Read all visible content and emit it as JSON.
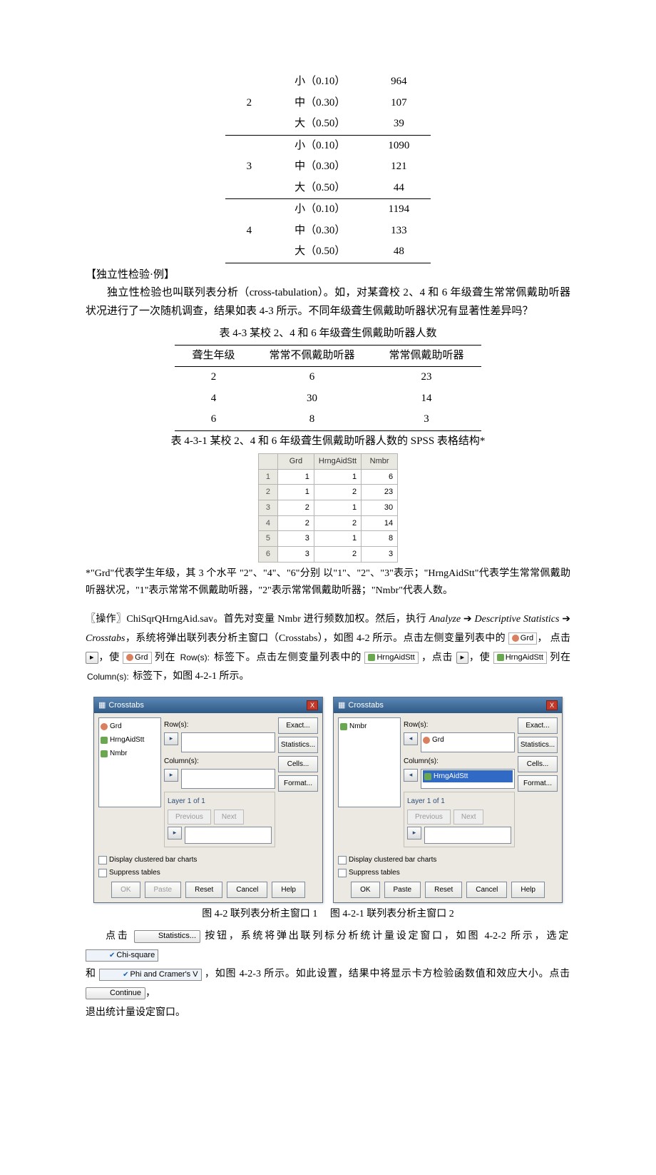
{
  "top_table": {
    "groups": [
      {
        "label": "2",
        "rows": [
          {
            "size": "小（0.10）",
            "n": "964"
          },
          {
            "size": "中（0.30）",
            "n": "107"
          },
          {
            "size": "大（0.50）",
            "n": "39"
          }
        ]
      },
      {
        "label": "3",
        "rows": [
          {
            "size": "小（0.10）",
            "n": "1090"
          },
          {
            "size": "中（0.30）",
            "n": "121"
          },
          {
            "size": "大（0.50）",
            "n": "44"
          }
        ]
      },
      {
        "label": "4",
        "rows": [
          {
            "size": "小（0.10）",
            "n": "1194"
          },
          {
            "size": "中（0.30）",
            "n": "133"
          },
          {
            "size": "大（0.50）",
            "n": "48"
          }
        ]
      }
    ]
  },
  "heading1": "【独立性检验·例】",
  "para1": "独立性检验也叫联列表分析（cross-tabulation）。如，对某聋校 2、4 和 6 年级聋生常常佩戴助听器状况进行了一次随机调查，结果如表 4-3 所示。不同年级聋生佩戴助听器状况有显著性差异吗？",
  "tbl43": {
    "caption": "表 4-3  某校 2、4 和 6 年级聋生佩戴助听器人数",
    "headers": [
      "聋生年级",
      "常常不佩戴助听器",
      "常常佩戴助听器"
    ],
    "rows": [
      [
        "2",
        "6",
        "23"
      ],
      [
        "4",
        "30",
        "14"
      ],
      [
        "6",
        "8",
        "3"
      ]
    ]
  },
  "tbl431_caption": "表 4-3-1  某校 2、4 和 6 年级聋生佩戴助听器人数的 SPSS 表格结构*",
  "spss_grid": {
    "cols": [
      "Grd",
      "HrngAidStt",
      "Nmbr"
    ],
    "rows": [
      [
        "1",
        "1",
        "1",
        "6"
      ],
      [
        "2",
        "1",
        "2",
        "23"
      ],
      [
        "3",
        "2",
        "1",
        "30"
      ],
      [
        "4",
        "2",
        "2",
        "14"
      ],
      [
        "5",
        "3",
        "1",
        "8"
      ],
      [
        "6",
        "3",
        "2",
        "3"
      ]
    ]
  },
  "footnote": "*\"Grd\"代表学生年级，其 3 个水平 \"2\"、\"4\"、\"6\"分别 以\"1\"、\"2\"、\"3\"表示；\"HrngAidStt\"代表学生常常佩戴助听器状况，\"1\"表示常常不佩戴助听器，\"2\"表示常常佩戴助听器；\"Nmbr\"代表人数。",
  "op": {
    "lead": "〖操作〗ChiSqrQHrngAid.sav。首先对变量 Nmbr 进行频数加权。然后，执行 ",
    "menu1": "Analyze",
    "arrow": "➔",
    "menu2": "Descriptive Statistics",
    "menu3": "Crosstabs",
    "after_menu": "，系统将弹出联列表分析主窗口（Crosstabs），如图 4-2 所示。点击左侧变量列表中的 ",
    "var_grd": "Grd",
    "comma1": "，",
    "click": "点击 ",
    "move_btn": "▸",
    "make": "，使 ",
    "listed_at": " 列在 ",
    "rows_label": "Row(s):",
    "under_label": " 标签下。点击左侧变量列表中的 ",
    "var_hrng": "HrngAidStt",
    "cols_label": "Column(s):",
    "tail": " 标签下，如图 4-2-1 所示。"
  },
  "dialog": {
    "title": "Crosstabs",
    "close": "X",
    "rows_label": "Row(s):",
    "cols_label": "Column(s):",
    "layer_label": "Layer 1 of 1",
    "prev": "Previous",
    "next": "Next",
    "side": {
      "exact": "Exact...",
      "statistics": "Statistics...",
      "cells": "Cells...",
      "format": "Format..."
    },
    "chk_bar": "Display clustered bar charts",
    "chk_suppress": "Suppress tables",
    "btns": {
      "ok": "OK",
      "paste": "Paste",
      "reset": "Reset",
      "cancel": "Cancel",
      "help": "Help"
    },
    "left": {
      "vars": [
        {
          "name": "Grd",
          "type": "nom"
        },
        {
          "name": "HrngAidStt",
          "type": "ord"
        },
        {
          "name": "Nmbr",
          "type": "ord"
        }
      ]
    },
    "right": {
      "vars": [
        {
          "name": "Nmbr",
          "type": "ord"
        }
      ],
      "row_var": "Grd",
      "col_var": "HrngAidStt"
    }
  },
  "fig_caption_left": "图 4-2  联列表分析主窗口 1",
  "fig_caption_right": "图 4-2-1  联列表分析主窗口 2",
  "last": {
    "p1a": "点击 ",
    "btn_stats": "Statistics...",
    "p1b": " 按钮，系统将弹出联列标分析统计量设定窗口，如图 4-2-2 所示，选定 ",
    "chk_chi": "Chi-square",
    "p2a": "和 ",
    "chk_phi": "Phi and Cramer's V",
    "p2b": " ，如图 4-2-3 所示。如此设置，结果中将显示卡方检验函数值和效应大小。点击 ",
    "btn_continue": "Continue",
    "p2c": "，",
    "p3": "退出统计量设定窗口。"
  }
}
